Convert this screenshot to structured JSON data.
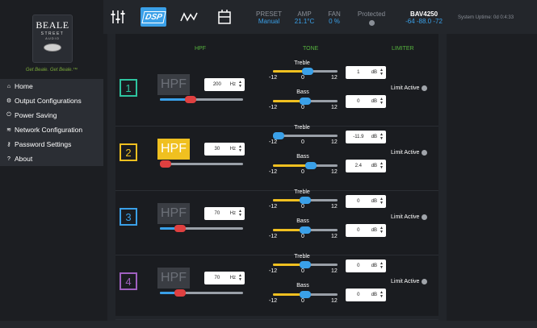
{
  "brand": {
    "name": "BEALE",
    "street": "STREET",
    "audio": "AUDIO",
    "tagline": "Get Beale. Get Beale.™"
  },
  "nav": [
    {
      "icon": "home-icon",
      "glyph": "⌂",
      "label": "Home"
    },
    {
      "icon": "gear-icon",
      "glyph": "⚙",
      "label": "Output Configurations"
    },
    {
      "icon": "power-icon",
      "glyph": "⏻",
      "label": "Power Saving"
    },
    {
      "icon": "wifi-icon",
      "glyph": "≋",
      "label": "Network Configuration"
    },
    {
      "icon": "key-icon",
      "glyph": "⚷",
      "label": "Password Settings"
    },
    {
      "icon": "question-icon",
      "glyph": "?",
      "label": "About"
    }
  ],
  "topbar": {
    "preset": {
      "label": "PRESET",
      "value": "Manual"
    },
    "amp": {
      "label": "AMP",
      "value": "21.1°C"
    },
    "fan": {
      "label": "FAN",
      "value": "0 %"
    },
    "protected": {
      "label": "Protected"
    },
    "model": {
      "label": "BAV4250",
      "value": "-64 -88.0 -72"
    },
    "uptime": "System Uptime: 0d 0:4:33"
  },
  "headers": {
    "hpf": "HPF",
    "tone": "TONE",
    "limiter": "LIMITER"
  },
  "tone_labels": {
    "treble": "Treble",
    "bass": "Bass",
    "min": "-12",
    "mid": "0",
    "max": "12"
  },
  "channels": [
    {
      "num": "1",
      "color": "#2ec4a0",
      "hpf_active": false,
      "hpf_label": "HPF",
      "hz": "200",
      "hz_unit": "Hz",
      "hpf_level": 0.35,
      "treble": "1",
      "bass": "0",
      "db_unit": "dB",
      "treble_level": 0.54,
      "bass_level": 0.5,
      "limiter": "Limit Active"
    },
    {
      "num": "2",
      "color": "#f0c020",
      "hpf_active": true,
      "hpf_label": "HPF",
      "hz": "30",
      "hz_unit": "Hz",
      "hpf_level": 0.0,
      "treble": "-11.9",
      "bass": "2.4",
      "db_unit": "dB",
      "treble_level": 0.0,
      "bass_level": 0.6,
      "limiter": "Limit Active"
    },
    {
      "num": "3",
      "color": "#3aa0e8",
      "hpf_active": false,
      "hpf_label": "HPF",
      "hz": "70",
      "hz_unit": "Hz",
      "hpf_level": 0.2,
      "treble": "0",
      "bass": "0",
      "db_unit": "dB",
      "treble_level": 0.5,
      "bass_level": 0.5,
      "limiter": "Limit Active"
    },
    {
      "num": "4",
      "color": "#a060c0",
      "hpf_active": false,
      "hpf_label": "HPF",
      "hz": "70",
      "hz_unit": "Hz",
      "hpf_level": 0.2,
      "treble": "0",
      "bass": "0",
      "db_unit": "dB",
      "treble_level": 0.5,
      "bass_level": 0.5,
      "limiter": "Limit Active"
    }
  ]
}
